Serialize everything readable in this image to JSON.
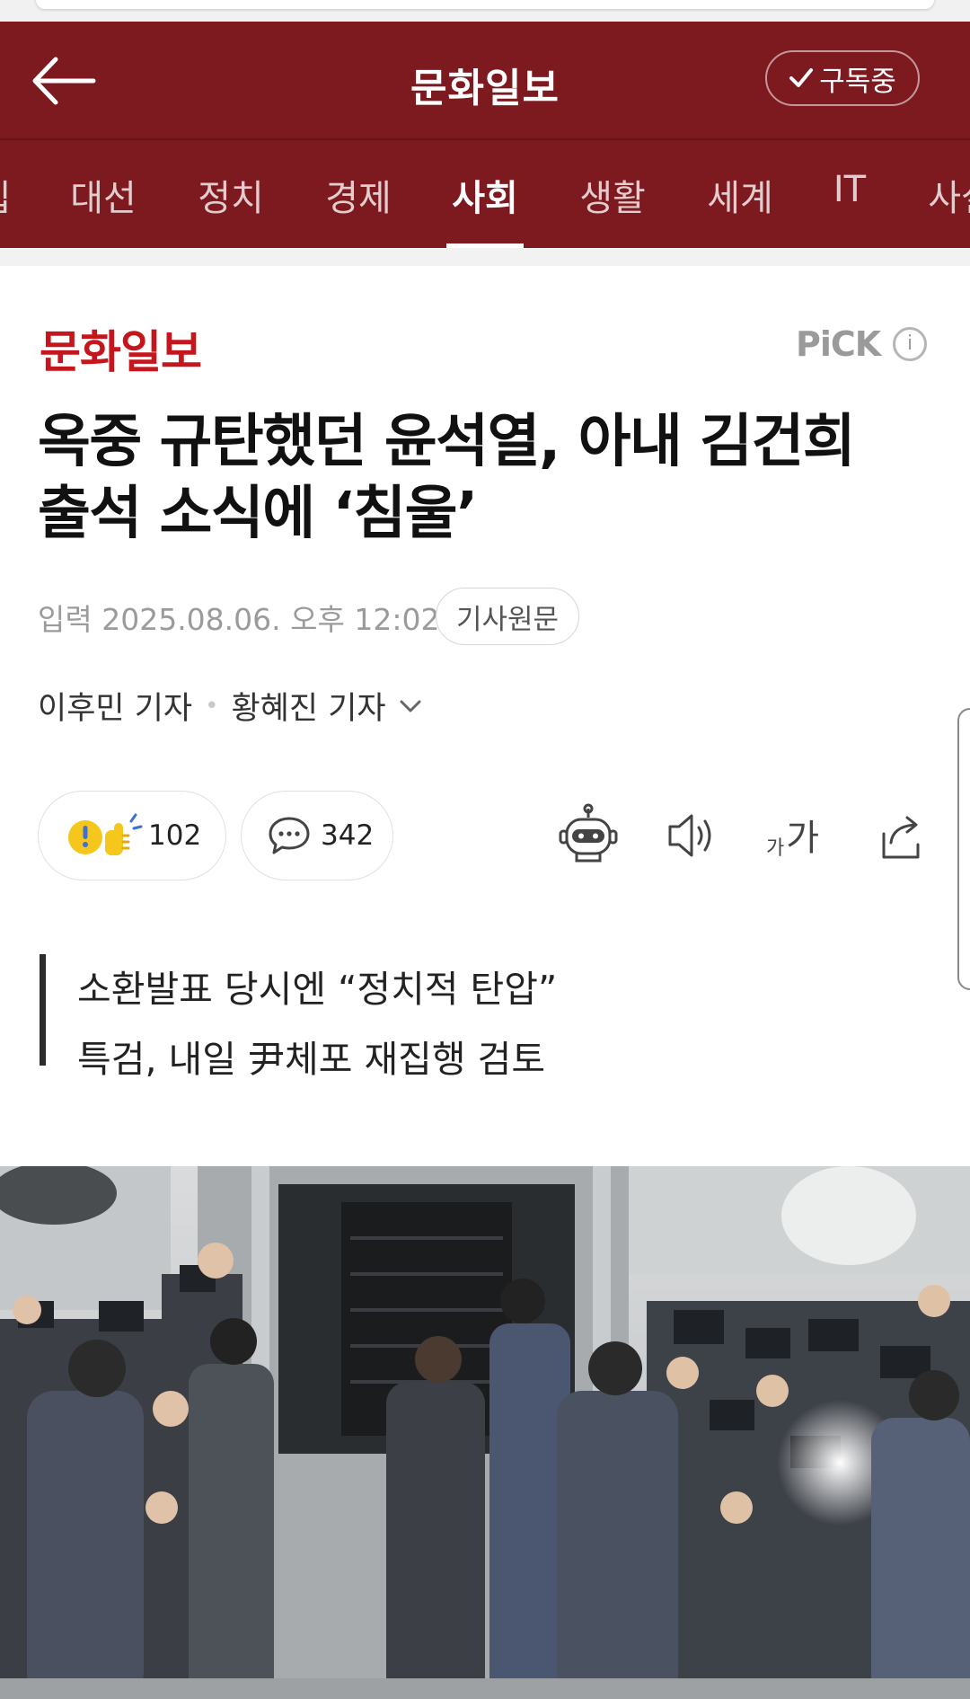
{
  "header": {
    "press_name": "문화일보",
    "subscribe_label": "구독중"
  },
  "tabs": [
    {
      "label": "칩"
    },
    {
      "label": "대선"
    },
    {
      "label": "정치"
    },
    {
      "label": "경제"
    },
    {
      "label": "사회",
      "active": true
    },
    {
      "label": "생활"
    },
    {
      "label": "세계"
    },
    {
      "label": "IT"
    },
    {
      "label": "사설"
    }
  ],
  "article": {
    "press_logo_text": "문화일보",
    "pick_label": "PiCK",
    "info_label": "i",
    "headline_lines": [
      "옥중 규탄했던 윤석열, 아내 김건희",
      "출석 소식에 ‘침울’"
    ],
    "date_text": "입력 2025.08.06. 오후 12:02",
    "original_button": "기사원문",
    "reporters": [
      "이후민 기자",
      "황혜진 기자"
    ],
    "reaction_count": "102",
    "comment_count": "342",
    "font_size_small": "가",
    "font_size_large": "가",
    "summary_lines": [
      "소환발표 당시엔 “정치적 탄압”",
      "특검, 내일 尹체포 재집행 검토"
    ]
  },
  "colors": {
    "header_bg": "#7c1a1f",
    "logo_red": "#c4161c"
  },
  "icons": [
    "back-arrow-icon",
    "check-icon",
    "info-icon",
    "chevron-down-icon",
    "reaction-emoji-icon",
    "comment-bubble-icon",
    "robot-summary-icon",
    "speaker-icon",
    "font-size-icon",
    "share-icon"
  ]
}
